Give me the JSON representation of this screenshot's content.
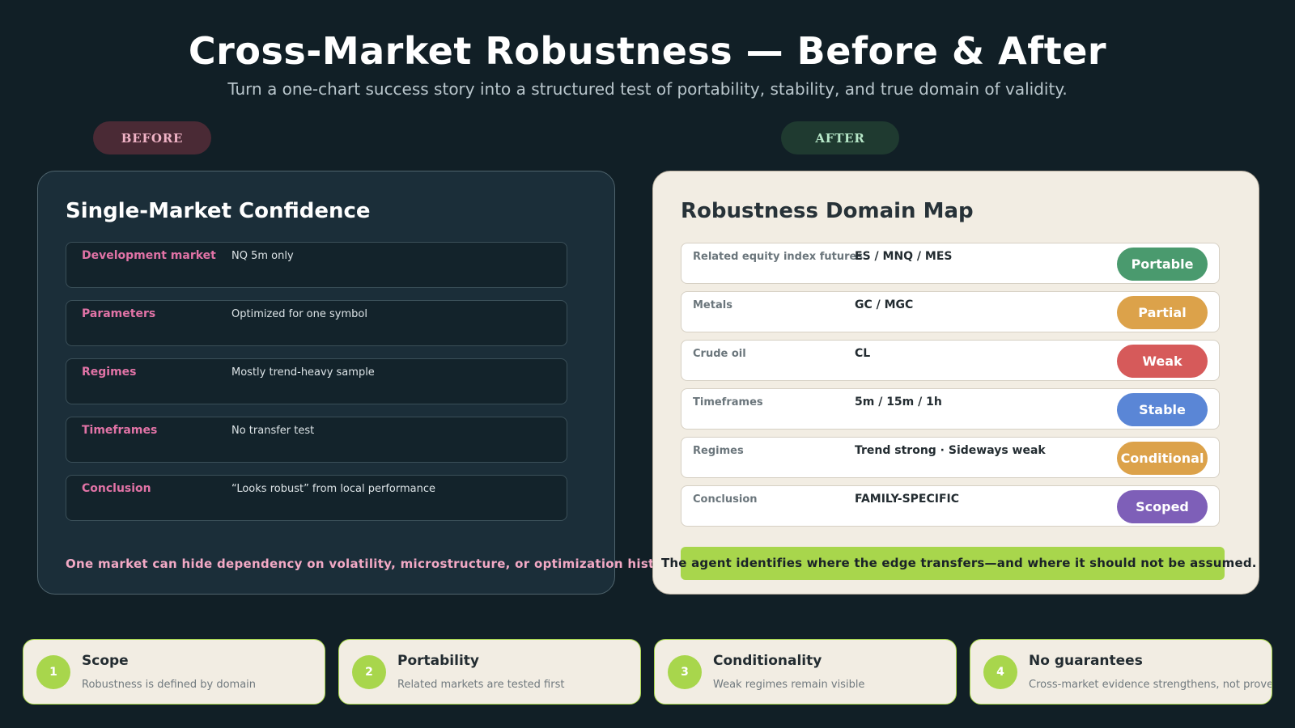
{
  "header": {
    "title": "Cross-Market Robustness — Before & After",
    "subtitle": "Turn a one-chart success story into a structured test of portability, stability, and true domain of validity."
  },
  "labels": {
    "before": "BEFORE",
    "after": "AFTER"
  },
  "before_panel": {
    "title": "Single-Market Confidence",
    "rows": [
      {
        "label": "Development market",
        "value": "NQ 5m only"
      },
      {
        "label": "Parameters",
        "value": "Optimized for one symbol"
      },
      {
        "label": "Regimes",
        "value": "Mostly trend-heavy sample"
      },
      {
        "label": "Timeframes",
        "value": "No transfer test"
      },
      {
        "label": "Conclusion",
        "value": "“Looks robust” from local performance"
      }
    ],
    "footer": "One market can hide dependency on volatility, microstructure, or optimization history."
  },
  "after_panel": {
    "title": "Robustness Domain Map",
    "rows": [
      {
        "label": "Related equity index futures",
        "value": "ES / MNQ / MES",
        "status": "Portable",
        "color": "#4a9a6e"
      },
      {
        "label": "Metals",
        "value": "GC / MGC",
        "status": "Partial",
        "color": "#dca24a"
      },
      {
        "label": "Crude oil",
        "value": "CL",
        "status": "Weak",
        "color": "#d65a5a"
      },
      {
        "label": "Timeframes",
        "value": "5m / 15m / 1h",
        "status": "Stable",
        "color": "#5a86d6"
      },
      {
        "label": "Regimes",
        "value": "Trend strong · Sideways weak",
        "status": "Conditional",
        "color": "#dca24a"
      },
      {
        "label": "Conclusion",
        "value": "FAMILY-SPECIFIC",
        "status": "Scoped",
        "color": "#7e5fb8"
      }
    ],
    "footer": "The agent identifies where the edge transfers—and where it should not be assumed."
  },
  "cards": [
    {
      "num": "1",
      "title": "Scope",
      "desc": "Robustness is defined by domain"
    },
    {
      "num": "2",
      "title": "Portability",
      "desc": "Related markets are tested first"
    },
    {
      "num": "3",
      "title": "Conditionality",
      "desc": "Weak regimes remain visible"
    },
    {
      "num": "4",
      "title": "No guarantees",
      "desc": "Cross-market evidence strengthens, not proves"
    }
  ]
}
